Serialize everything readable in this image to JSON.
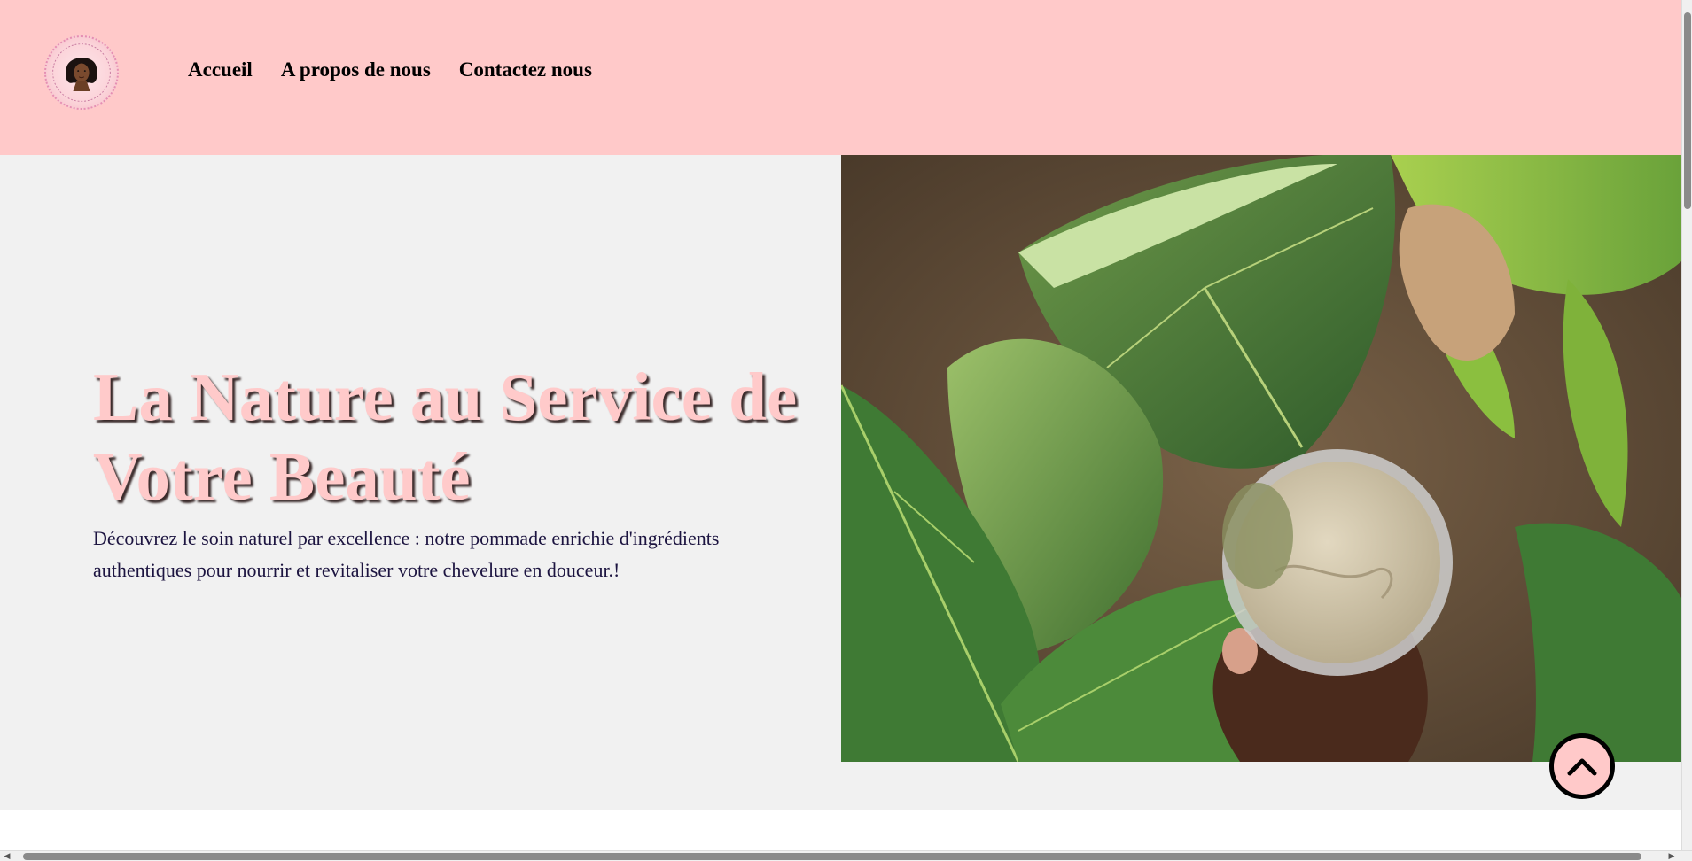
{
  "header": {
    "logo_icon": "logo-woman-portrait-icon",
    "background_color": "#ffc9c9",
    "nav": [
      {
        "label": "Accueil"
      },
      {
        "label": "A propos de nous"
      },
      {
        "label": "Contactez nous"
      }
    ]
  },
  "hero": {
    "title": "La Nature au Service de Votre Beauté",
    "description": "Découvrez le soin naturel par excellence : notre pommade enrichie d'ingrédients authentiques pour nourrir et revitaliser votre chevelure en douceur.!",
    "title_color": "#ffcaca",
    "text_color": "#1c1440",
    "background_color": "#f1f1f1"
  },
  "back_to_top": {
    "icon": "chevron-up-icon"
  }
}
